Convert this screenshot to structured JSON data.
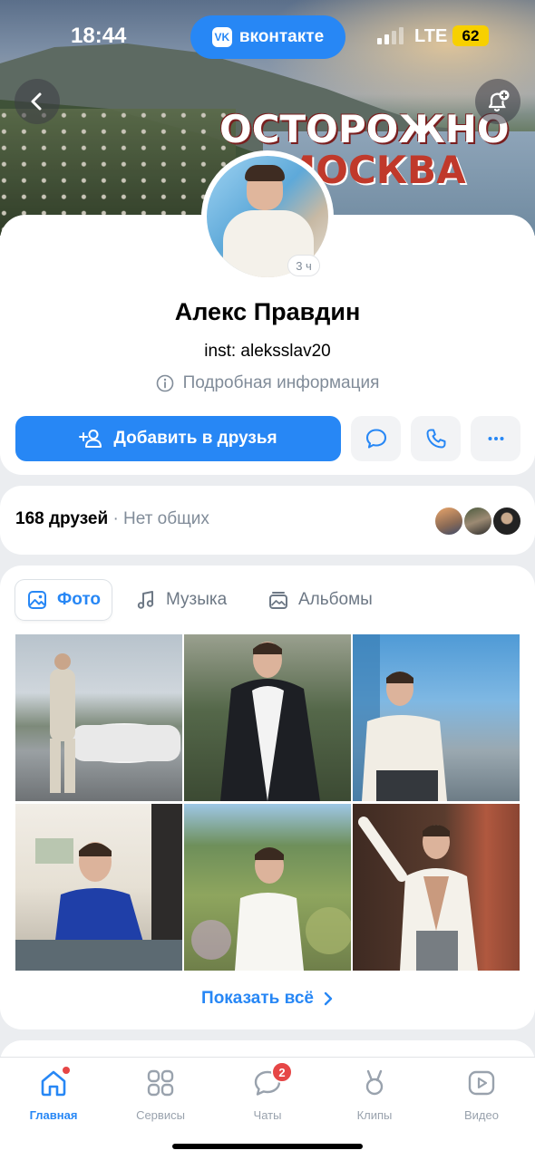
{
  "status_bar": {
    "time": "18:44",
    "carrier_app": "вконтакте",
    "network": "LTE",
    "battery": "62"
  },
  "cover": {
    "title_line1": "ОСТОРОЖНО",
    "title_line2": "МОСКВА"
  },
  "profile": {
    "story_age": "3 ч",
    "name": "Алекс Правдин",
    "status": "inst: aleksslav20",
    "details_link": "Подробная информация",
    "add_friend_label": "Добавить в друзья"
  },
  "friends": {
    "count": "168 друзей",
    "separator": "·",
    "mutual": "Нет общих"
  },
  "media": {
    "tabs": [
      {
        "label": "Фото",
        "icon": "photo-icon",
        "active": true
      },
      {
        "label": "Музыка",
        "icon": "music-note-icon",
        "active": false
      },
      {
        "label": "Альбомы",
        "icon": "albums-icon",
        "active": false
      }
    ],
    "show_all": "Показать всё",
    "photo_count_visible": 6
  },
  "bottom_nav": {
    "items": [
      {
        "label": "Главная",
        "icon": "home-icon",
        "active": true,
        "dot": true
      },
      {
        "label": "Сервисы",
        "icon": "services-grid-icon",
        "active": false
      },
      {
        "label": "Чаты",
        "icon": "chat-bubble-icon",
        "active": false,
        "badge": "2"
      },
      {
        "label": "Клипы",
        "icon": "clips-icon",
        "active": false
      },
      {
        "label": "Видео",
        "icon": "video-icon",
        "active": false
      }
    ]
  },
  "colors": {
    "accent": "#2787f5",
    "secondary_text": "#818c99",
    "badge": "#e64646",
    "battery": "#f7d000"
  }
}
